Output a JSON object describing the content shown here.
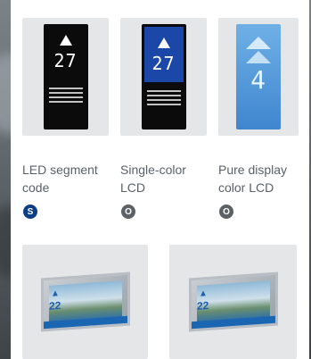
{
  "products": [
    {
      "label": "LED segment\ncode",
      "badge": "S",
      "badge_color": "#0d3f85",
      "display_number": "27"
    },
    {
      "label": "Single-color\nLCD",
      "badge": "O",
      "badge_color": "#5c6166",
      "display_number": "27"
    },
    {
      "label": "Pure display\ncolor LCD",
      "badge": "O",
      "badge_color": "#5c6166",
      "display_number": "4"
    }
  ],
  "bottom_displays": [
    {
      "display_number": "22"
    },
    {
      "display_number": "22"
    }
  ]
}
